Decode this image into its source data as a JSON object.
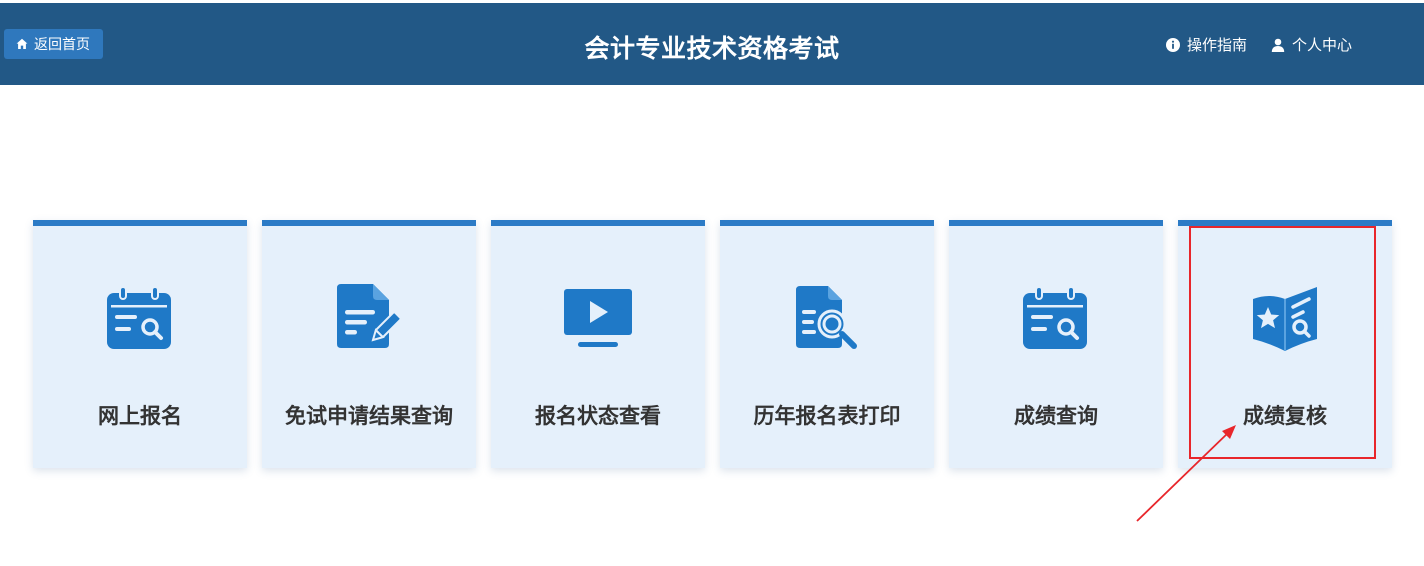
{
  "header": {
    "home_label": "返回首页",
    "title": "会计专业技术资格考试",
    "guide_label": "操作指南",
    "user_label": "个人中心"
  },
  "cards": [
    {
      "label": "网上报名",
      "icon": "calendar-search-icon"
    },
    {
      "label": "免试申请结果查询",
      "icon": "document-edit-icon"
    },
    {
      "label": "报名状态查看",
      "icon": "video-screen-icon"
    },
    {
      "label": "历年报名表打印",
      "icon": "document-search-icon"
    },
    {
      "label": "成绩查询",
      "icon": "calendar-search-icon"
    },
    {
      "label": "成绩复核",
      "icon": "book-star-search-icon"
    }
  ],
  "colors": {
    "header_bg": "#225886",
    "card_bg": "#e5f0fb",
    "card_accent": "#2c7bc6",
    "highlight": "#e8262b"
  }
}
